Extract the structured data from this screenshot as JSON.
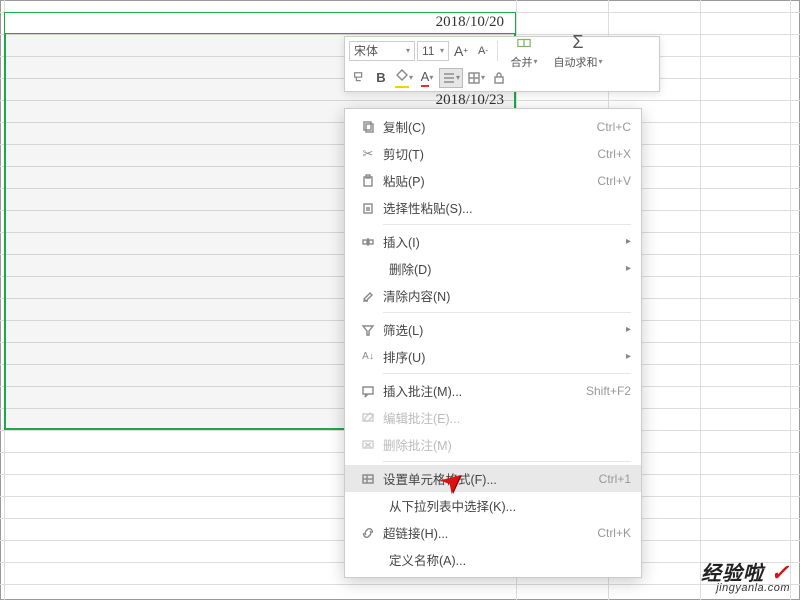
{
  "cells": {
    "date1": "2018/10/20",
    "date2": "2018/10/23"
  },
  "toolbar": {
    "font_name": "宋体",
    "font_size": "11",
    "inc_font": "A⁺",
    "dec_font": "A⁻",
    "merge": "合并",
    "autosum": "自动求和",
    "bold": "B",
    "font_color": "A",
    "sigma": "Σ"
  },
  "menu": {
    "copy": {
      "label": "复制(C)",
      "accel": "Ctrl+C"
    },
    "cut": {
      "label": "剪切(T)",
      "accel": "Ctrl+X"
    },
    "paste": {
      "label": "粘贴(P)",
      "accel": "Ctrl+V"
    },
    "pastespec": {
      "label": "选择性粘贴(S)..."
    },
    "insert": {
      "label": "插入(I)"
    },
    "delete": {
      "label": "删除(D)"
    },
    "clear": {
      "label": "清除内容(N)"
    },
    "filter": {
      "label": "筛选(L)"
    },
    "sort": {
      "label": "排序(U)"
    },
    "inscomment": {
      "label": "插入批注(M)...",
      "accel": "Shift+F2"
    },
    "editcomment": {
      "label": "编辑批注(E)..."
    },
    "delcomment": {
      "label": "删除批注(M)"
    },
    "format": {
      "label": "设置单元格格式(F)...",
      "accel": "Ctrl+1"
    },
    "dropdown": {
      "label": "从下拉列表中选择(K)..."
    },
    "hyperlink": {
      "label": "超链接(H)...",
      "accel": "Ctrl+K"
    },
    "defname": {
      "label": "定义名称(A)..."
    }
  },
  "watermark": {
    "main": "经验啦",
    "sub": "jingyanla.com"
  }
}
